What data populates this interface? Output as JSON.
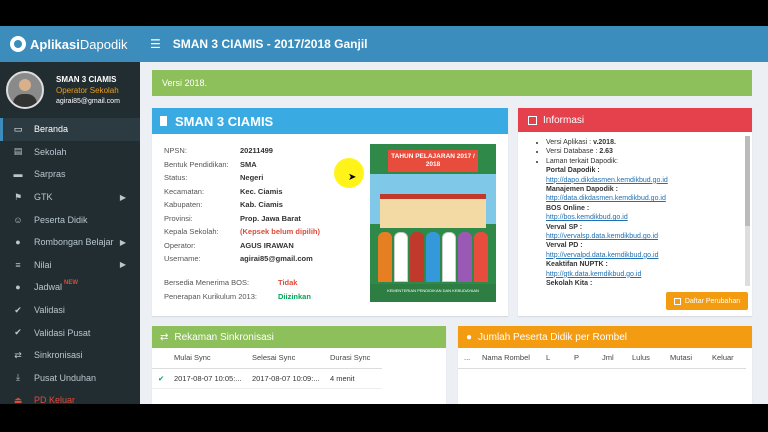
{
  "app": {
    "brand_bold": "Aplikasi",
    "brand_thin": "Dapodik",
    "title": "SMAN 3 CIAMIS - 2017/2018 Ganjil"
  },
  "user": {
    "name": "SMAN 3 CIAMIS",
    "role": "Operator Sekolah",
    "email": "agirai85@gmail.com"
  },
  "menu": [
    {
      "label": "Beranda",
      "icon": "desktop-icon"
    },
    {
      "label": "Sekolah",
      "icon": "building-icon"
    },
    {
      "label": "Sarpras",
      "icon": "truck-icon"
    },
    {
      "label": "GTK",
      "icon": "teacher-icon"
    },
    {
      "label": "Peserta Didik",
      "icon": "smile-icon"
    },
    {
      "label": "Rombongan Belajar",
      "icon": "users-icon"
    },
    {
      "label": "Nilai",
      "icon": "list-icon"
    },
    {
      "label": "Jadwal",
      "icon": "group-icon",
      "badge": "NEW"
    },
    {
      "label": "Validasi",
      "icon": "check-icon"
    },
    {
      "label": "Validasi Pusat",
      "icon": "check-double-icon"
    },
    {
      "label": "Sinkronisasi",
      "icon": "exchange-icon"
    },
    {
      "label": "Pusat Unduhan",
      "icon": "download-icon"
    },
    {
      "label": "PD Keluar",
      "icon": "logout-icon"
    }
  ],
  "alert": "Versi 2018.",
  "school": {
    "title": "SMAN 3 CIAMIS",
    "fields": [
      {
        "k": "NPSN:",
        "v": "20211499"
      },
      {
        "k": "Bentuk Pendidikan:",
        "v": "SMA"
      },
      {
        "k": "Status:",
        "v": "Negeri"
      },
      {
        "k": "Kecamatan:",
        "v": "Kec. Ciamis"
      },
      {
        "k": "Kabupaten:",
        "v": "Kab. Ciamis"
      },
      {
        "k": "Provinsi:",
        "v": "Prop. Jawa Barat"
      },
      {
        "k": "Kepala Sekolah:",
        "v": "(Kepsek belum dipilih)"
      },
      {
        "k": "Operator:",
        "v": "AGUS IRAWAN"
      },
      {
        "k": "Username:",
        "v": "agirai85@gmail.com"
      }
    ],
    "bos_label": "Bersedia Menerima BOS:",
    "bos_value": "Tidak",
    "kurikulum_label": "Penerapan Kurikulum 2013:",
    "kurikulum_value": "Diizinkan",
    "poster_banner": "TAHUN PELAJARAN 2017 / 2018",
    "poster_footer": "KEMENTERIAN PENDIDIKAN DAN KEBUDAYAAN"
  },
  "info": {
    "title": "Informasi",
    "versi_aplikasi_label": "Versi Aplikasi : ",
    "versi_aplikasi": "v.2018.",
    "versi_db_label": "Versi Database : ",
    "versi_db": "2.63",
    "laman": "Laman terkait Dapodik:",
    "links": [
      {
        "name": "Portal Dapodik :",
        "url": "http://dapo.dikdasmen.kemdikbud.go.id"
      },
      {
        "name": "Manajemen Dapodik :",
        "url": "http://data.dikdasmen.kemdikbud.go.id"
      },
      {
        "name": "BOS Online :",
        "url": "http://bos.kemdikbud.go.id"
      },
      {
        "name": "Verval SP :",
        "url": "http://vervalsp.data.kemdikbud.go.id"
      },
      {
        "name": "Verval PD :",
        "url": "http://vervalpd.data.kemdikbud.go.id"
      },
      {
        "name": "Keaktifan NUPTK :",
        "url": "http://gtk.data.kemdikbud.go.id"
      },
      {
        "name": "Sekolah Kita :",
        "url": ""
      }
    ],
    "button": "Daftar Perubahan"
  },
  "sync": {
    "title": "Rekaman Sinkronisasi",
    "headers": [
      "Mulai Sync",
      "Selesai Sync",
      "Durasi Sync"
    ],
    "rows": [
      {
        "mulai": "2017-08-07 10:05:...",
        "selesai": "2017-08-07 10:09:...",
        "durasi": "4 menit"
      }
    ]
  },
  "peserta": {
    "title": "Jumlah Peserta Didik per Rombel",
    "headers": [
      "...",
      "Nama Rombel",
      "L",
      "P",
      "Jml",
      "Lulus",
      "Mutasi",
      "Keluar"
    ]
  }
}
